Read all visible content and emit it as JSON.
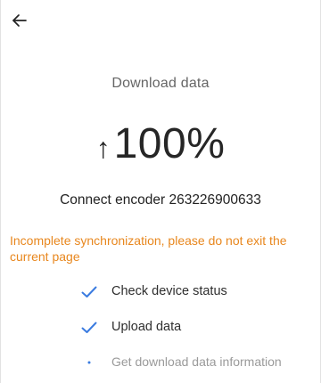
{
  "header": {
    "back_icon": "arrow-left-icon"
  },
  "page": {
    "title": "Download data"
  },
  "progress": {
    "arrow": "↑",
    "value": "100%",
    "fraction": 1.0
  },
  "device": {
    "line": "Connect encoder 263226900633"
  },
  "warning": {
    "text": "Incomplete synchronization, please do not exit the current page",
    "color": "#e8871e"
  },
  "steps": [
    {
      "label": "Check device status",
      "status": "done",
      "icon": "check-icon"
    },
    {
      "label": "Upload data",
      "status": "done",
      "icon": "check-icon"
    },
    {
      "label": "Get download data information",
      "status": "pending",
      "icon": "dot-icon"
    }
  ],
  "colors": {
    "check": "#3a7be0",
    "pending_text": "#9a9a9a"
  }
}
